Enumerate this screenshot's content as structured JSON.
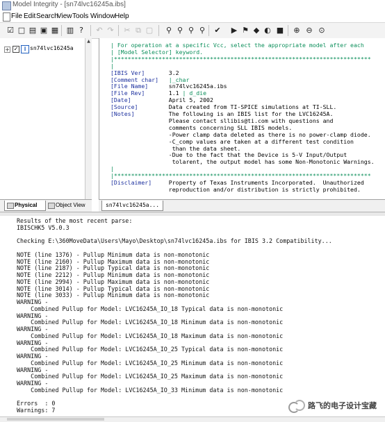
{
  "window": {
    "title": "Model Integrity - [sn74lvc16245a.ibs]"
  },
  "menu": [
    "File",
    "Edit",
    "Search",
    "View",
    "Tools",
    "Window",
    "Help"
  ],
  "toolbar": {
    "icons": [
      "check-icon",
      "new-file-icon",
      "open-folder-icon",
      "save-icon",
      "save-all-icon",
      "print-icon",
      "help-icon",
      "undo-icon",
      "redo-icon",
      "cut-icon",
      "copy-icon",
      "paste-icon",
      "find-icon",
      "find-next-icon",
      "find-prev-icon",
      "replace-icon",
      "check-syntax-icon",
      "run-icon",
      "bookmark-icon",
      "compile-icon",
      "simulate-icon",
      "stop-icon",
      "zoom-in-icon",
      "zoom-out-icon",
      "zoom-fit-icon"
    ],
    "glyphs": [
      "☑",
      "□",
      "▤",
      "▣",
      "▦",
      "▥",
      "?",
      "↶",
      "↷",
      "✂",
      "⧉",
      "▢",
      "⚲",
      "⚲",
      "⚲",
      "⚲",
      "✔",
      "▶",
      "⚑",
      "◆",
      "◐",
      "■",
      "⊕",
      "⊖",
      "⊙"
    ]
  },
  "tree": {
    "root_label": "sn74lvc16245a",
    "expander": "+",
    "checkbox": "✓",
    "icon_letter": "I"
  },
  "left_tabs": [
    "Physical",
    "Object View"
  ],
  "source": {
    "lines": [
      {
        "parts": [
          {
            "t": "| For operation at a specific Vcc, select the appropriate model after each",
            "c": "cm"
          }
        ]
      },
      {
        "parts": [
          {
            "t": "| [Model Selector] keyword.",
            "c": "cm"
          }
        ]
      },
      {
        "parts": [
          {
            "t": "|***************************************************************************",
            "c": "cm"
          }
        ]
      },
      {
        "parts": [
          {
            "t": "|",
            "c": "cm"
          }
        ]
      },
      {
        "parts": [
          {
            "t": "[IBIS Ver]",
            "c": "kw"
          },
          {
            "t": "       3.2",
            "c": "vl"
          }
        ]
      },
      {
        "parts": [
          {
            "t": "[Comment char]",
            "c": "kw"
          },
          {
            "t": "   |_char",
            "c": "cm"
          }
        ]
      },
      {
        "parts": [
          {
            "t": "[File Name]",
            "c": "kw"
          },
          {
            "t": "      sn74lvc16245a.ibs",
            "c": "vl"
          }
        ]
      },
      {
        "parts": [
          {
            "t": "[File Rev]",
            "c": "kw"
          },
          {
            "t": "       1.1 ",
            "c": "vl"
          },
          {
            "t": "| d_die",
            "c": "cm"
          }
        ]
      },
      {
        "parts": [
          {
            "t": "[Date]",
            "c": "kw"
          },
          {
            "t": "           April 5, 2002",
            "c": "vl"
          }
        ]
      },
      {
        "parts": [
          {
            "t": "[Source]",
            "c": "kw"
          },
          {
            "t": "         Data created from TI-SPICE simulations at TI-SLL.",
            "c": "vl"
          }
        ]
      },
      {
        "parts": [
          {
            "t": "[Notes]",
            "c": "kw"
          },
          {
            "t": "          The following is an IBIS list for the LVC16245A.",
            "c": "vl"
          }
        ]
      },
      {
        "parts": [
          {
            "t": "                 Please contact sllibis@ti.com with questions and",
            "c": "vl"
          }
        ]
      },
      {
        "parts": [
          {
            "t": "                 comments concerning SLL IBIS models.",
            "c": "vl"
          }
        ]
      },
      {
        "parts": [
          {
            "t": "                 -Power clamp data deleted as there is no power-clamp diode.",
            "c": "vl"
          }
        ]
      },
      {
        "parts": [
          {
            "t": "                 -C_comp values are taken at a different test condition",
            "c": "vl"
          }
        ]
      },
      {
        "parts": [
          {
            "t": "                  than the data sheet.",
            "c": "vl"
          }
        ]
      },
      {
        "parts": [
          {
            "t": "                 -Due to the fact that the Device is 5-V Input/Output",
            "c": "vl"
          }
        ]
      },
      {
        "parts": [
          {
            "t": "                  tolarent, the output model has some Non-Monotonic Warnings.",
            "c": "vl"
          }
        ]
      },
      {
        "parts": [
          {
            "t": "|",
            "c": "cm"
          }
        ]
      },
      {
        "parts": [
          {
            "t": "|***************************************************************************",
            "c": "cm"
          }
        ]
      },
      {
        "parts": [
          {
            "t": "[Disclaimer]",
            "c": "kw"
          },
          {
            "t": "     Property of Texas Instruments Incorporated.  Unauthorized",
            "c": "vl"
          }
        ]
      },
      {
        "parts": [
          {
            "t": "                 reproduction and/or distribution is strictly prohibited.",
            "c": "vl"
          }
        ]
      }
    ]
  },
  "file_tab": "sn74lvc16245a...",
  "output": {
    "lines": [
      "Results of the most recent parse:",
      "IBISCHK5 V5.0.3",
      "",
      "Checking E:\\360MoveData\\Users\\Mayo\\Desktop\\sn74lvc16245a.ibs for IBIS 3.2 Compatibility...",
      "",
      "NOTE (line 1376) - Pullup Minimum data is non-monotonic",
      "NOTE (line 2160) - Pullup Maximum data is non-monotonic",
      "NOTE (line 2187) - Pullup Typical data is non-monotonic",
      "NOTE (line 2212) - Pullup Minimum data is non-monotonic",
      "NOTE (line 2994) - Pullup Maximum data is non-monotonic",
      "NOTE (line 3014) - Pullup Typical data is non-monotonic",
      "NOTE (line 3033) - Pullup Minimum data is non-monotonic",
      "WARNING -",
      "    Combined Pullup for Model: LVC16245A_IO_18 Typical data is non-monotonic",
      "WARNING -",
      "    Combined Pullup for Model: LVC16245A_IO_18 Minimum data is non-monotonic",
      "WARNING -",
      "    Combined Pullup for Model: LVC16245A_IO_18 Maximum data is non-monotonic",
      "WARNING -",
      "    Combined Pullup for Model: LVC16245A_IO_25 Typical data is non-monotonic",
      "WARNING -",
      "    Combined Pullup for Model: LVC16245A_IO_25 Minimum data is non-monotonic",
      "WARNING -",
      "    Combined Pullup for Model: LVC16245A_IO_25 Maximum data is non-monotonic",
      "WARNING -",
      "    Combined Pullup for Model: LVC16245A_IO_33 Minimum data is non-monotonic",
      "",
      "Errors  : 0",
      "Warnings: 7"
    ]
  },
  "watermark": "路飞的电子设计宝藏"
}
